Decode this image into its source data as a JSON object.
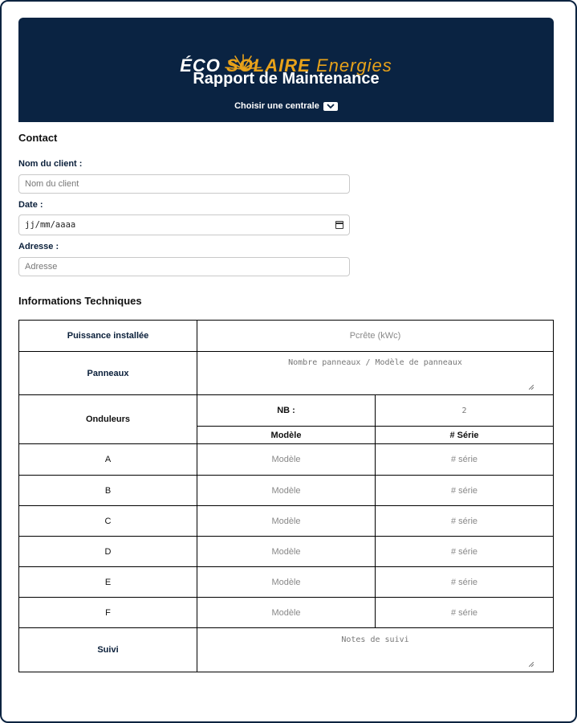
{
  "brand": {
    "eco": "ÉCO",
    "solaire": "SOLAIRE",
    "energies": "Energies",
    "colors": {
      "navy": "#0a2342",
      "gold": "#e8a21a"
    }
  },
  "header": {
    "title": "Rapport de Maintenance",
    "selector_label": "Choisir une centrale",
    "selector_icon": "chevron-down-icon"
  },
  "contact": {
    "section_title": "Contact",
    "client_label": "Nom du client :",
    "client_placeholder": "Nom du client",
    "date_label": "Date :",
    "date_placeholder": "jj/mm/aaaa",
    "address_label": "Adresse :",
    "address_placeholder": "Adresse"
  },
  "technique": {
    "section_title": "Informations Techniques",
    "puissance_label": "Puissance installée",
    "puissance_placeholder": "Pcrête (kWc)",
    "panneaux_label": "Panneaux",
    "panneaux_placeholder": "Nombre panneaux / Modèle de panneaux",
    "onduleurs_label": "Onduleurs",
    "nb_label": "NB :",
    "nb_value": "2",
    "modele_header": "Modèle",
    "serie_header": "# Série",
    "rows": [
      {
        "label": "A",
        "modele": "Modèle",
        "serie": "# série"
      },
      {
        "label": "B",
        "modele": "Modèle",
        "serie": "# série"
      },
      {
        "label": "C",
        "modele": "Modèle",
        "serie": "# série"
      },
      {
        "label": "D",
        "modele": "Modèle",
        "serie": "# série"
      },
      {
        "label": "E",
        "modele": "Modèle",
        "serie": "# série"
      },
      {
        "label": "F",
        "modele": "Modèle",
        "serie": "# série"
      }
    ],
    "suivi_label": "Suivi",
    "suivi_placeholder": "Notes de suivi"
  }
}
